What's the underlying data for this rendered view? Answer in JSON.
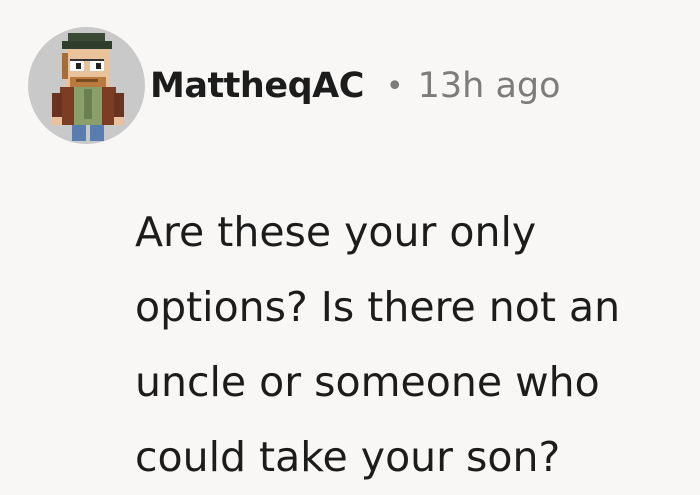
{
  "comment": {
    "author": "MattheqAC",
    "separator": "•",
    "time": "13h ago",
    "text": "Are these your only options? Is there not an uncle or someone who could take your son?"
  },
  "avatar": {
    "icon": "pixel-character-avatar",
    "background_color": "#c9c9c9"
  },
  "colors": {
    "page_background": "#f8f7f6",
    "text": "#1c1c1c",
    "muted": "#7c7c7c"
  }
}
